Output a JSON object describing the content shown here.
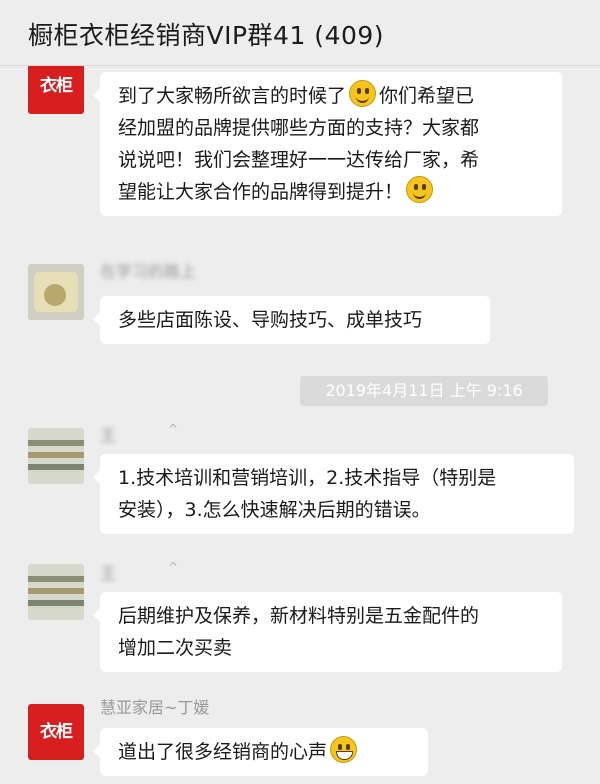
{
  "header": {
    "title": "橱柜衣柜经销商VIP群41 (409)"
  },
  "messages": [
    {
      "sender": "",
      "avatar": "brand-logo",
      "lines": [
        "到了大家畅所欲言的时候了",
        "你们希望已",
        "经加盟的品牌提供哪些方面的支持？大家都",
        "说说吧！我们会整理好一一达传给厂家，希",
        "望能让大家合作的品牌得到提升！"
      ],
      "emojis": [
        "smile-icon",
        "smile-icon"
      ]
    },
    {
      "sender": "在学习的路上",
      "avatar": "photo",
      "lines": [
        "多些店面陈设、导购技巧、成单技巧"
      ]
    },
    {
      "sender": "王",
      "avatar": "money-photo",
      "lines": [
        "1.技术培训和营销培训，2.技术指导（特别是",
        "安装），3.怎么快速解决后期的错误。"
      ]
    },
    {
      "sender": "王",
      "avatar": "money-photo",
      "lines": [
        "后期维护及保养，新材料特别是五金配件的",
        "增加二次买卖"
      ]
    },
    {
      "sender": "慧亚家居~丁媛",
      "avatar": "brand-logo",
      "lines": [
        "道出了很多经销商的心声"
      ],
      "emojis": [
        "grin-icon"
      ]
    }
  ],
  "timestamp": "2019年4月11日 上午 9:16",
  "avatars": {
    "brand_logo_text": "衣柜",
    "brand_color": "#d81e1e"
  },
  "sender_caret": "^"
}
